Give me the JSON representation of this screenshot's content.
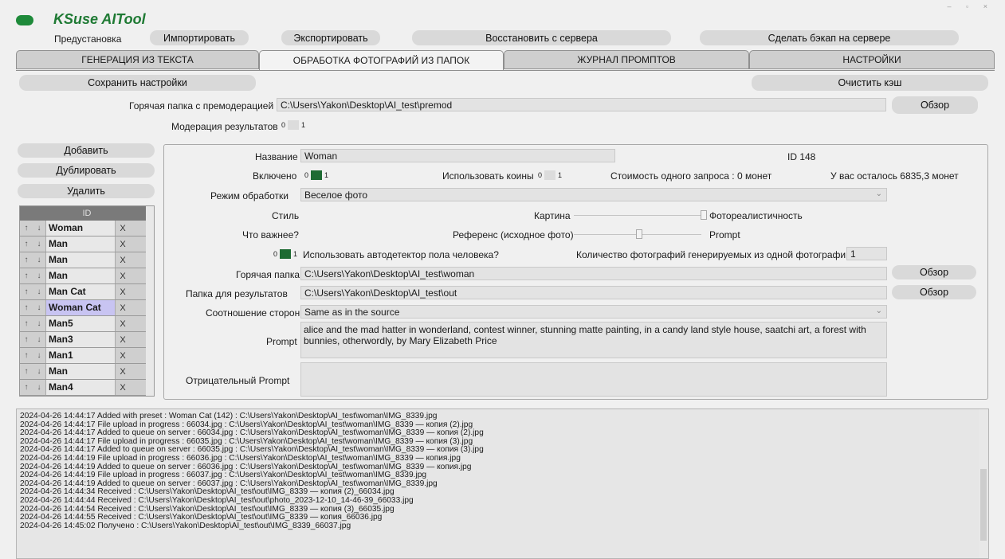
{
  "app": {
    "title": "KSuse AITool",
    "window_controls": [
      "–",
      "▫",
      "×"
    ]
  },
  "toolbar": {
    "preset_label": "Предустановка",
    "import": "Импортировать",
    "export": "Экспортировать",
    "restore": "Восстановить с сервера",
    "backup": "Сделать бэкап на сервере"
  },
  "tabs": [
    {
      "label": "ГЕНЕРАЦИЯ ИЗ ТЕКСТА"
    },
    {
      "label": "ОБРАБОТКА ФОТОГРАФИЙ ИЗ ПАПОК"
    },
    {
      "label": "ЖУРНАЛ ПРОМПТОВ"
    },
    {
      "label": "НАСТРОЙКИ"
    }
  ],
  "actions": {
    "save": "Сохранить настройки",
    "clear_cache": "Очистить кэш"
  },
  "hot_premod": {
    "label": "Горячая папка с премодерацией",
    "value": "C:\\Users\\Yakon\\Desktop\\AI_test\\premod",
    "browse": "Обзор"
  },
  "moderation": {
    "label": "Модерация результатов",
    "off": "0",
    "on": "1"
  },
  "list_buttons": {
    "add": "Добавить",
    "duplicate": "Дублировать",
    "delete": "Удалить"
  },
  "list": {
    "header": "ID",
    "up": "↑",
    "down": "↓",
    "remove": "X",
    "rows": [
      {
        "name": "Woman"
      },
      {
        "name": "Man"
      },
      {
        "name": "Man"
      },
      {
        "name": "Man"
      },
      {
        "name": "Man Cat"
      },
      {
        "name": "Woman Cat"
      },
      {
        "name": "Man5"
      },
      {
        "name": "Man3"
      },
      {
        "name": "Man1"
      },
      {
        "name": "Man"
      },
      {
        "name": "Man4"
      }
    ],
    "selected_index": 5
  },
  "form": {
    "name_label": "Название",
    "name_value": "Woman",
    "id_text": "ID 148",
    "enabled_label": "Включено",
    "toggle_off": "0",
    "toggle_on": "1",
    "coins_label": "Использовать коины",
    "cost_text": "Стоимость одного запроса : 0 монет",
    "balance_text": "У вас осталось 6835,3 монет",
    "mode_label": "Режим обработки",
    "mode_value": "Веселое фото",
    "style_label": "Стиль",
    "style_left": "Картина",
    "style_right": "Фотореалистичность",
    "importance_label": "Что важнее?",
    "importance_left": "Референс (исходное фото)",
    "importance_right": "Prompt",
    "gender_label": "Использовать автодетектор пола человека?",
    "count_label": "Количество фотографий генерируемых из одной фотографии",
    "count_value": "1",
    "hot_label": "Горячая папка",
    "hot_value": "C:\\Users\\Yakon\\Desktop\\AI_test\\woman",
    "out_label": "Папка для результатов",
    "out_value": "C:\\Users\\Yakon\\Desktop\\AI_test\\out",
    "browse": "Обзор",
    "ratio_label": "Соотношение сторон",
    "ratio_value": "Same as in the source",
    "prompt_label": "Prompt",
    "prompt_value": "alice and the mad hatter in wonderland, contest winner, stunning matte painting, in a candy land style house, saatchi art, a forest with bunnies, otherwordly, by Mary Elizabeth Price",
    "neg_label": "Отрицательный Prompt",
    "neg_value": "",
    "dropdown_arrow": "⌄"
  },
  "log": [
    "2024-04-26 14:44:17 Added with preset : Woman Cat (142) : C:\\Users\\Yakon\\Desktop\\AI_test\\woman\\IMG_8339.jpg",
    "2024-04-26 14:44:17 File upload in progress : 66034.jpg : C:\\Users\\Yakon\\Desktop\\AI_test\\woman\\IMG_8339 — копия (2).jpg",
    "2024-04-26 14:44:17 Added to queue on server : 66034.jpg : C:\\Users\\Yakon\\Desktop\\AI_test\\woman\\IMG_8339 — копия (2).jpg",
    "2024-04-26 14:44:17 File upload in progress : 66035.jpg : C:\\Users\\Yakon\\Desktop\\AI_test\\woman\\IMG_8339 — копия (3).jpg",
    "2024-04-26 14:44:17 Added to queue on server : 66035.jpg : C:\\Users\\Yakon\\Desktop\\AI_test\\woman\\IMG_8339 — копия (3).jpg",
    "2024-04-26 14:44:19 File upload in progress : 66036.jpg : C:\\Users\\Yakon\\Desktop\\AI_test\\woman\\IMG_8339 — копия.jpg",
    "2024-04-26 14:44:19 Added to queue on server : 66036.jpg : C:\\Users\\Yakon\\Desktop\\AI_test\\woman\\IMG_8339 — копия.jpg",
    "2024-04-26 14:44:19 File upload in progress : 66037.jpg : C:\\Users\\Yakon\\Desktop\\AI_test\\woman\\IMG_8339.jpg",
    "2024-04-26 14:44:19 Added to queue on server : 66037.jpg : C:\\Users\\Yakon\\Desktop\\AI_test\\woman\\IMG_8339.jpg",
    "2024-04-26 14:44:34 Received : C:\\Users\\Yakon\\Desktop\\AI_test\\out\\IMG_8339 — копия (2)_66034.jpg",
    "2024-04-26 14:44:44 Received : C:\\Users\\Yakon\\Desktop\\AI_test\\out\\photo_2023-12-10_14-46-39_66033.jpg",
    "2024-04-26 14:44:54 Received : C:\\Users\\Yakon\\Desktop\\AI_test\\out\\IMG_8339 — копия (3)_66035.jpg",
    "2024-04-26 14:44:55 Received : C:\\Users\\Yakon\\Desktop\\AI_test\\out\\IMG_8339 — копия_66036.jpg",
    "2024-04-26 14:45:02 Получено : C:\\Users\\Yakon\\Desktop\\AI_test\\out\\IMG_8339_66037.jpg"
  ],
  "colors": {
    "accent_green": "#1e6b33",
    "selected_row": "#c8c4f2"
  }
}
